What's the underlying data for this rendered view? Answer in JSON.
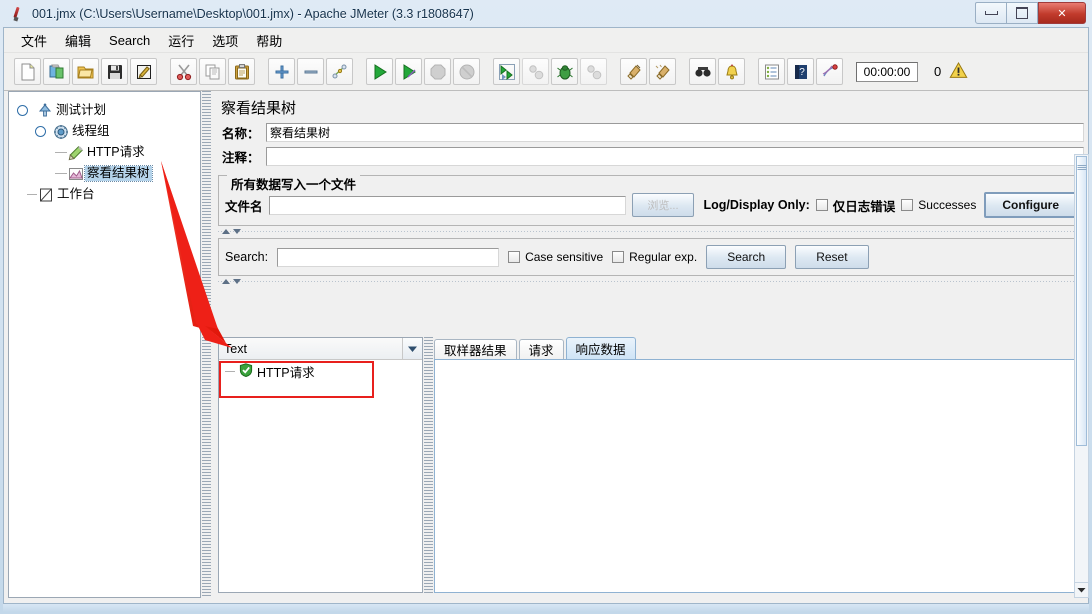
{
  "window": {
    "title": "001.jmx (C:\\Users\\Username\\Desktop\\001.jmx) - Apache JMeter (3.3 r1808647)",
    "icon": "jmeter-feather-icon",
    "minimize_label": "",
    "maximize_label": "",
    "close_label": "✕"
  },
  "menubar": {
    "items": [
      {
        "label": "文件",
        "name": "menu-file"
      },
      {
        "label": "编辑",
        "name": "menu-edit"
      },
      {
        "label": "Search",
        "name": "menu-search"
      },
      {
        "label": "运行",
        "name": "menu-run"
      },
      {
        "label": "选项",
        "name": "menu-options"
      },
      {
        "label": "帮助",
        "name": "menu-help"
      }
    ]
  },
  "toolbar": {
    "buttons": [
      {
        "icon": "new-document-icon",
        "name": "toolbar-new"
      },
      {
        "icon": "templates-icon",
        "name": "toolbar-templates"
      },
      {
        "icon": "open-folder-icon",
        "name": "toolbar-open"
      },
      {
        "icon": "save-floppy-icon",
        "name": "toolbar-save"
      },
      {
        "icon": "save-as-icon",
        "name": "toolbar-save-as"
      },
      {
        "icon": "cut-scissors-icon",
        "name": "toolbar-cut"
      },
      {
        "icon": "copy-icon",
        "name": "toolbar-copy"
      },
      {
        "icon": "paste-clipboard-icon",
        "name": "toolbar-paste"
      },
      {
        "icon": "expand-plus-icon",
        "name": "toolbar-expand-all"
      },
      {
        "icon": "collapse-minus-icon",
        "name": "toolbar-collapse-all"
      },
      {
        "icon": "toggle-icon",
        "name": "toolbar-toggle"
      },
      {
        "icon": "start-play-icon",
        "name": "toolbar-start"
      },
      {
        "icon": "start-no-pause-icon",
        "name": "toolbar-start-no-timers"
      },
      {
        "icon": "stop-octagon-icon",
        "name": "toolbar-stop"
      },
      {
        "icon": "shutdown-icon",
        "name": "toolbar-shutdown"
      },
      {
        "icon": "remote-start-icon",
        "name": "toolbar-remote-start-all"
      },
      {
        "icon": "remote-stop-icon",
        "name": "toolbar-remote-stop-all"
      },
      {
        "icon": "bug-icon",
        "name": "toolbar-remote-shutdown-all"
      },
      {
        "icon": "remote-clear-icon",
        "name": "toolbar-remote-exit-all"
      },
      {
        "icon": "clear-broom-icon",
        "name": "toolbar-clear"
      },
      {
        "icon": "clear-all-broom-icon",
        "name": "toolbar-clear-all"
      },
      {
        "icon": "search-binoculars-icon",
        "name": "toolbar-search"
      },
      {
        "icon": "search-reset-bell-icon",
        "name": "toolbar-search-reset"
      },
      {
        "icon": "function-helper-list-icon",
        "name": "toolbar-function-helper"
      },
      {
        "icon": "help-book-icon",
        "name": "toolbar-help"
      },
      {
        "icon": "undo-scribble-icon",
        "name": "toolbar-undo"
      }
    ],
    "timer": "00:00:00",
    "error_count": "0",
    "warning_icon": "warning-triangle-icon"
  },
  "tree": {
    "nodes": [
      {
        "label": "测试计划",
        "icon": "test-plan-icon",
        "name": "tree-node-test-plan",
        "selected": false
      },
      {
        "label": "线程组",
        "icon": "thread-group-icon",
        "name": "tree-node-thread-group",
        "selected": false
      },
      {
        "label": "HTTP请求",
        "icon": "http-request-icon",
        "name": "tree-node-http-request",
        "selected": false
      },
      {
        "label": "察看结果树",
        "icon": "view-results-tree-icon",
        "name": "tree-node-view-results-tree",
        "selected": true
      },
      {
        "label": "工作台",
        "icon": "workbench-icon",
        "name": "tree-node-workbench",
        "selected": false
      }
    ]
  },
  "main": {
    "panel_title": "察看结果树",
    "name_label": "名称：",
    "name_value": "察看结果树",
    "comment_label": "注释：",
    "comment_value": "",
    "file_group": {
      "title": "所有数据写入一个文件",
      "filename_label": "文件名",
      "filename_value": "",
      "browse_label": "浏览...",
      "log_display_label": "Log/Display Only:",
      "errors_only_label": "仅日志错误",
      "errors_only_checked": false,
      "successes_label": "Successes",
      "successes_checked": false,
      "configure_label": "Configure"
    },
    "search_bar": {
      "label": "Search:",
      "value": "",
      "case_sensitive_label": "Case sensitive",
      "case_sensitive_checked": false,
      "regular_exp_label": "Regular exp.",
      "regular_exp_checked": false,
      "search_button": "Search",
      "reset_button": "Reset"
    },
    "results": {
      "renderer_selected": "Text",
      "items": [
        {
          "label": "HTTP请求",
          "status": "success",
          "icon": "success-shield-icon",
          "name": "result-item-http-request"
        }
      ]
    },
    "tabs": [
      {
        "label": "取样器结果",
        "name": "tab-sampler-result",
        "active": false
      },
      {
        "label": "请求",
        "name": "tab-request",
        "active": false
      },
      {
        "label": "响应数据",
        "name": "tab-response-data",
        "active": true
      }
    ],
    "tab_content": ""
  },
  "annotation": {
    "arrow_color": "#ee2017",
    "highlight_color": "#e8201d",
    "from": "tree-node-view-results-tree",
    "to": "result-item-http-request"
  }
}
